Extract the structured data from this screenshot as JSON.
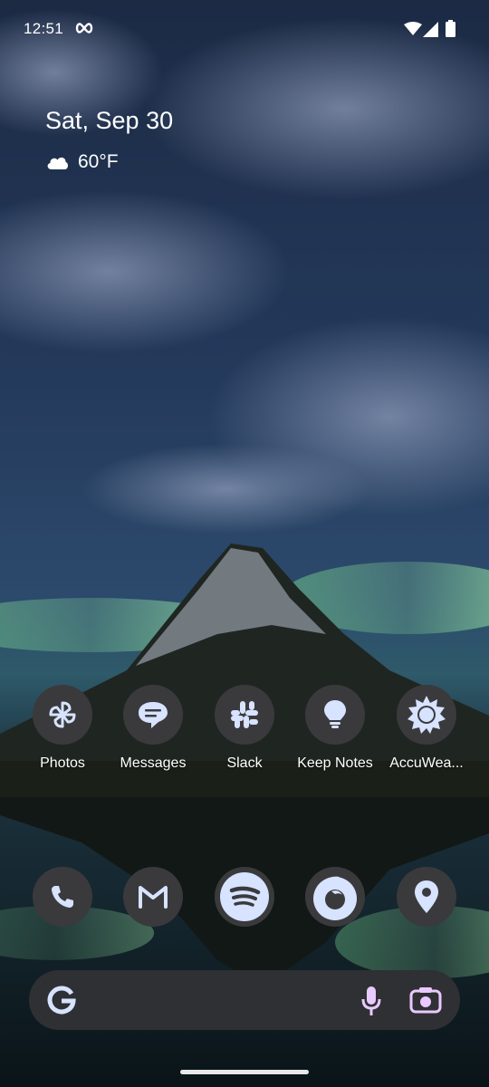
{
  "status_bar": {
    "time": "12:51",
    "icons": [
      "infinity-icon",
      "wifi-icon",
      "signal-icon",
      "battery-icon"
    ]
  },
  "widget": {
    "date": "Sat, Sep 30",
    "temperature": "60°F",
    "weather_icon": "cloud-icon"
  },
  "apps": [
    {
      "label": "Photos",
      "icon": "pinwheel-icon"
    },
    {
      "label": "Messages",
      "icon": "chat-bubble-icon"
    },
    {
      "label": "Slack",
      "icon": "slack-icon"
    },
    {
      "label": "Keep Notes",
      "icon": "lightbulb-icon"
    },
    {
      "label": "AccuWea...",
      "icon": "sun-icon"
    }
  ],
  "dock": [
    {
      "icon": "phone-icon"
    },
    {
      "icon": "gmail-icon"
    },
    {
      "icon": "spotify-icon"
    },
    {
      "icon": "firefox-icon"
    },
    {
      "icon": "maps-pin-icon"
    }
  ],
  "search": {
    "logo": "google-g-icon",
    "mic": "microphone-icon",
    "lens": "lens-camera-icon"
  },
  "colors": {
    "icon_bg": "#3a3a3d",
    "icon_fg": "#d7e3ff",
    "search_bg": "#2f3033"
  }
}
